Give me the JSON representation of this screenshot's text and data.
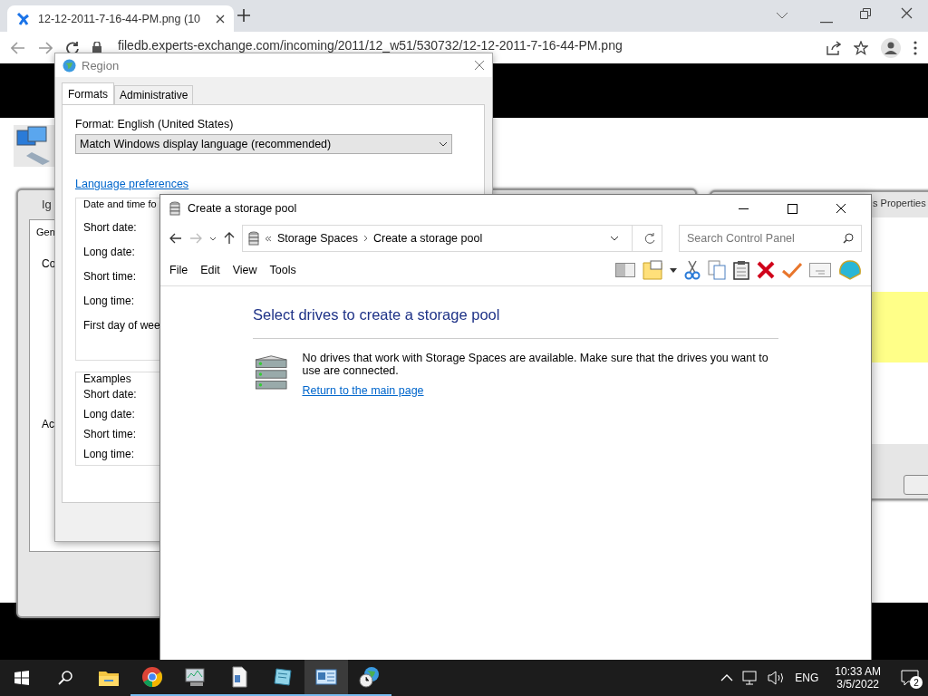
{
  "browser": {
    "tab_title": "12-12-2011-7-16-44-PM.png (10",
    "address": "filedb.experts-exchange.com/incoming/2011/12_w51/530732/12-12-2011-7-16-44-PM.png"
  },
  "background_windows": [
    {
      "kind": "tabbed",
      "title": "Ig",
      "tab": "Gen",
      "labels": [
        "Co",
        "Ac"
      ]
    },
    {
      "kind": "properties",
      "title": "s Properties"
    }
  ],
  "region_dialog": {
    "title": "Region",
    "tabs": [
      {
        "label": "Formats",
        "selected": true
      },
      {
        "label": "Administrative",
        "selected": false
      }
    ],
    "format_label": "Format: English (United States)",
    "format_value": "Match Windows display language (recommended)",
    "link": "Language preferences",
    "date_time_group": {
      "title": "Date and time fo",
      "labels": [
        "Short date:",
        "Long date:",
        "Short time:",
        "Long time:",
        "First day of wee"
      ]
    },
    "examples_group": {
      "title": "Examples",
      "labels": [
        "Short date:",
        "Long date:",
        "Short time:",
        "Long time:"
      ]
    }
  },
  "storage_window": {
    "title": "Create a storage pool",
    "breadcrumb": [
      "Storage Spaces",
      "Create a storage pool"
    ],
    "search": {
      "placeholder": "Search Control Panel"
    },
    "menu": [
      "File",
      "Edit",
      "View",
      "Tools"
    ],
    "heading": "Select drives to create a storage pool",
    "message": "No drives that work with Storage Spaces are available. Make sure that the drives you want to use are connected.",
    "link": "Return to the main page"
  },
  "taskbar": {
    "apps": [
      {
        "kind": "explorer",
        "running": false,
        "selected": false
      },
      {
        "kind": "chrome",
        "running": true,
        "selected": false
      },
      {
        "kind": "monitor",
        "running": true,
        "selected": false
      },
      {
        "kind": "document",
        "running": true,
        "selected": false
      },
      {
        "kind": "notepad",
        "running": true,
        "selected": false
      },
      {
        "kind": "control",
        "running": true,
        "selected": true
      },
      {
        "kind": "globe",
        "running": true,
        "selected": false
      }
    ],
    "language": "ENG",
    "time": "10:33 AM",
    "date": "3/5/2022",
    "notifications": "2"
  }
}
